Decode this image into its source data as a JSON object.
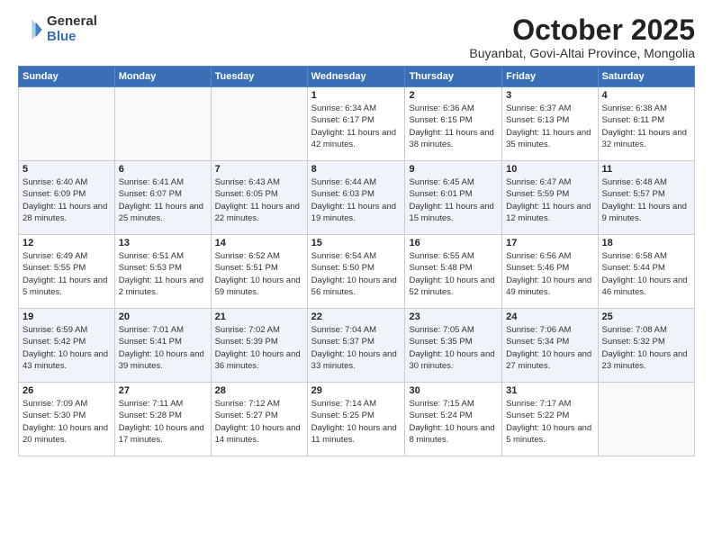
{
  "logo": {
    "general": "General",
    "blue": "Blue"
  },
  "title": "October 2025",
  "subtitle": "Buyanbat, Govi-Altai Province, Mongolia",
  "days_of_week": [
    "Sunday",
    "Monday",
    "Tuesday",
    "Wednesday",
    "Thursday",
    "Friday",
    "Saturday"
  ],
  "weeks": [
    [
      {
        "day": "",
        "info": ""
      },
      {
        "day": "",
        "info": ""
      },
      {
        "day": "",
        "info": ""
      },
      {
        "day": "1",
        "info": "Sunrise: 6:34 AM\nSunset: 6:17 PM\nDaylight: 11 hours\nand 42 minutes."
      },
      {
        "day": "2",
        "info": "Sunrise: 6:36 AM\nSunset: 6:15 PM\nDaylight: 11 hours\nand 38 minutes."
      },
      {
        "day": "3",
        "info": "Sunrise: 6:37 AM\nSunset: 6:13 PM\nDaylight: 11 hours\nand 35 minutes."
      },
      {
        "day": "4",
        "info": "Sunrise: 6:38 AM\nSunset: 6:11 PM\nDaylight: 11 hours\nand 32 minutes."
      }
    ],
    [
      {
        "day": "5",
        "info": "Sunrise: 6:40 AM\nSunset: 6:09 PM\nDaylight: 11 hours\nand 28 minutes."
      },
      {
        "day": "6",
        "info": "Sunrise: 6:41 AM\nSunset: 6:07 PM\nDaylight: 11 hours\nand 25 minutes."
      },
      {
        "day": "7",
        "info": "Sunrise: 6:43 AM\nSunset: 6:05 PM\nDaylight: 11 hours\nand 22 minutes."
      },
      {
        "day": "8",
        "info": "Sunrise: 6:44 AM\nSunset: 6:03 PM\nDaylight: 11 hours\nand 19 minutes."
      },
      {
        "day": "9",
        "info": "Sunrise: 6:45 AM\nSunset: 6:01 PM\nDaylight: 11 hours\nand 15 minutes."
      },
      {
        "day": "10",
        "info": "Sunrise: 6:47 AM\nSunset: 5:59 PM\nDaylight: 11 hours\nand 12 minutes."
      },
      {
        "day": "11",
        "info": "Sunrise: 6:48 AM\nSunset: 5:57 PM\nDaylight: 11 hours\nand 9 minutes."
      }
    ],
    [
      {
        "day": "12",
        "info": "Sunrise: 6:49 AM\nSunset: 5:55 PM\nDaylight: 11 hours\nand 5 minutes."
      },
      {
        "day": "13",
        "info": "Sunrise: 6:51 AM\nSunset: 5:53 PM\nDaylight: 11 hours\nand 2 minutes."
      },
      {
        "day": "14",
        "info": "Sunrise: 6:52 AM\nSunset: 5:51 PM\nDaylight: 10 hours\nand 59 minutes."
      },
      {
        "day": "15",
        "info": "Sunrise: 6:54 AM\nSunset: 5:50 PM\nDaylight: 10 hours\nand 56 minutes."
      },
      {
        "day": "16",
        "info": "Sunrise: 6:55 AM\nSunset: 5:48 PM\nDaylight: 10 hours\nand 52 minutes."
      },
      {
        "day": "17",
        "info": "Sunrise: 6:56 AM\nSunset: 5:46 PM\nDaylight: 10 hours\nand 49 minutes."
      },
      {
        "day": "18",
        "info": "Sunrise: 6:58 AM\nSunset: 5:44 PM\nDaylight: 10 hours\nand 46 minutes."
      }
    ],
    [
      {
        "day": "19",
        "info": "Sunrise: 6:59 AM\nSunset: 5:42 PM\nDaylight: 10 hours\nand 43 minutes."
      },
      {
        "day": "20",
        "info": "Sunrise: 7:01 AM\nSunset: 5:41 PM\nDaylight: 10 hours\nand 39 minutes."
      },
      {
        "day": "21",
        "info": "Sunrise: 7:02 AM\nSunset: 5:39 PM\nDaylight: 10 hours\nand 36 minutes."
      },
      {
        "day": "22",
        "info": "Sunrise: 7:04 AM\nSunset: 5:37 PM\nDaylight: 10 hours\nand 33 minutes."
      },
      {
        "day": "23",
        "info": "Sunrise: 7:05 AM\nSunset: 5:35 PM\nDaylight: 10 hours\nand 30 minutes."
      },
      {
        "day": "24",
        "info": "Sunrise: 7:06 AM\nSunset: 5:34 PM\nDaylight: 10 hours\nand 27 minutes."
      },
      {
        "day": "25",
        "info": "Sunrise: 7:08 AM\nSunset: 5:32 PM\nDaylight: 10 hours\nand 23 minutes."
      }
    ],
    [
      {
        "day": "26",
        "info": "Sunrise: 7:09 AM\nSunset: 5:30 PM\nDaylight: 10 hours\nand 20 minutes."
      },
      {
        "day": "27",
        "info": "Sunrise: 7:11 AM\nSunset: 5:28 PM\nDaylight: 10 hours\nand 17 minutes."
      },
      {
        "day": "28",
        "info": "Sunrise: 7:12 AM\nSunset: 5:27 PM\nDaylight: 10 hours\nand 14 minutes."
      },
      {
        "day": "29",
        "info": "Sunrise: 7:14 AM\nSunset: 5:25 PM\nDaylight: 10 hours\nand 11 minutes."
      },
      {
        "day": "30",
        "info": "Sunrise: 7:15 AM\nSunset: 5:24 PM\nDaylight: 10 hours\nand 8 minutes."
      },
      {
        "day": "31",
        "info": "Sunrise: 7:17 AM\nSunset: 5:22 PM\nDaylight: 10 hours\nand 5 minutes."
      },
      {
        "day": "",
        "info": ""
      }
    ]
  ]
}
